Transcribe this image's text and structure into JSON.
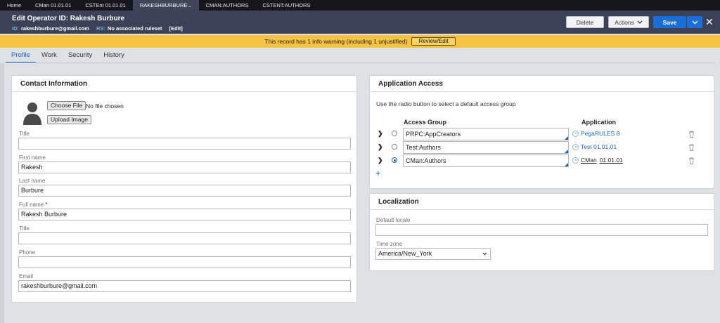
{
  "tabs": [
    "Home",
    "CMan 01.01.01",
    "CSTEnt 01.01.01",
    "RAKESHBURBURE...",
    "CMAN:AUTHORS",
    "CSTENT:AUTHORS"
  ],
  "header": {
    "title": "Edit  Operator ID: Rakesh Burbure",
    "id_key": "ID:",
    "id_value": "rakeshburbure@gmail.com",
    "rs_key": "RS:",
    "rs_value": "No associated ruleset",
    "edit_link": "[Edit]",
    "delete_label": "Delete",
    "actions_label": "Actions",
    "save_label": "Save"
  },
  "warning": {
    "text": "This record has 1 info warning (including 1 unjustified)",
    "button": "Review/Edit"
  },
  "subtabs": [
    "Profile",
    "Work",
    "Security",
    "History"
  ],
  "contact": {
    "heading": "Contact Information",
    "choose_file": "Choose File",
    "no_file": "No file chosen",
    "upload": "Upload Image",
    "title_label": "Title",
    "title_value": "",
    "first_name_label": "First name",
    "first_name_value": "Rakesh",
    "last_name_label": "Last name",
    "last_name_value": "Burbure",
    "full_name_label": "Full name",
    "full_name_required": "*",
    "full_name_value": "Rakesh Burbure",
    "title2_label": "Title",
    "title2_value": "",
    "phone_label": "Phone",
    "phone_value": "",
    "email_label": "Email",
    "email_value": "rakeshburbure@gmail.com"
  },
  "app_access": {
    "heading": "Application Access",
    "hint": "Use the radio button to select a default access group",
    "col_group": "Access Group",
    "col_app": "Application",
    "rows": [
      {
        "group": "PRPC:AppCreators",
        "app_name": "PegaRULES",
        "app_version": "8",
        "selected": false
      },
      {
        "group": "Test:Authors",
        "app_name": "Test",
        "app_version": "01.01.01",
        "selected": false
      },
      {
        "group": "CMan:Authors",
        "app_name": "CMan",
        "app_version": "01.01.01",
        "selected": true
      }
    ]
  },
  "localization": {
    "heading": "Localization",
    "locale_label": "Default locale",
    "locale_value": "",
    "tz_label": "Time zone",
    "tz_value": "America/New_York"
  }
}
